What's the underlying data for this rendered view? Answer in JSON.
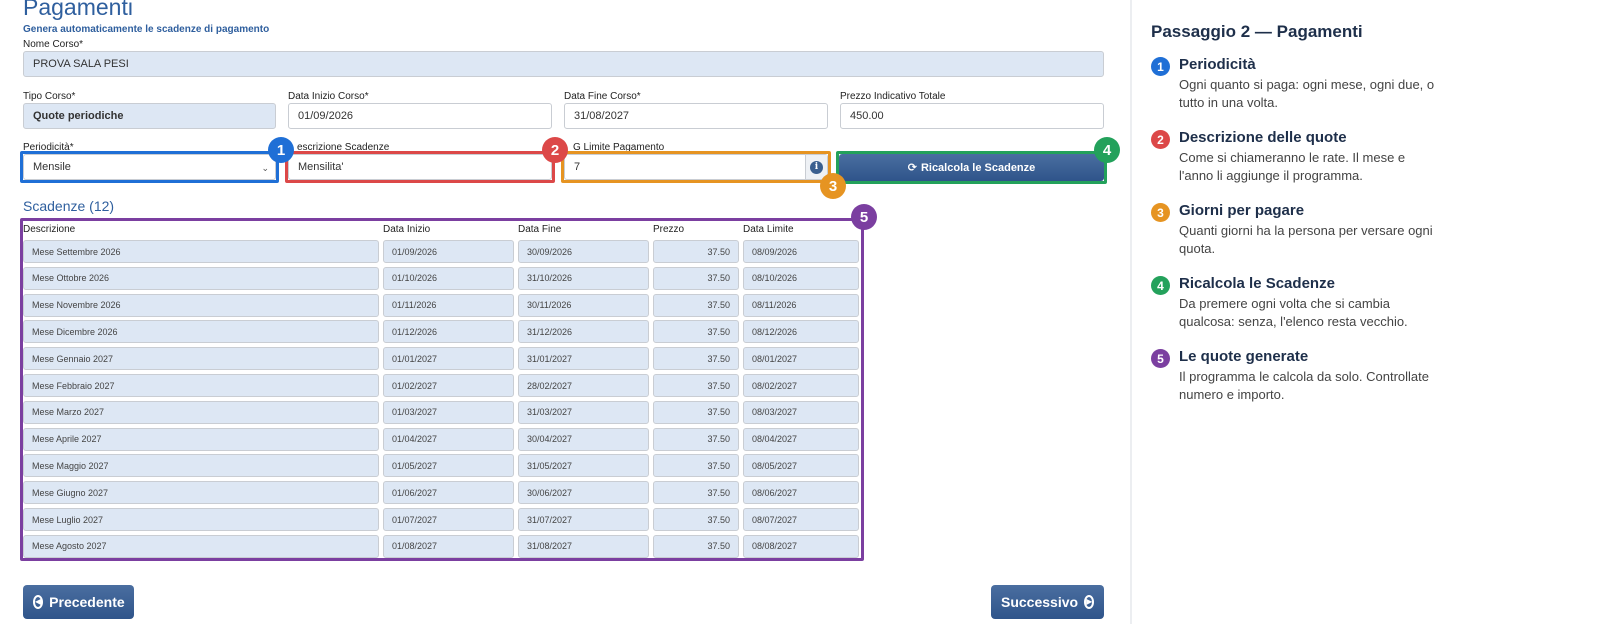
{
  "header": {
    "title": "Pagamenti",
    "subtitle": "Genera automaticamente le scadenze di pagamento"
  },
  "form": {
    "nome_corso_label": "Nome Corso*",
    "nome_corso_value": "PROVA SALA PESI",
    "tipo_corso_label": "Tipo Corso*",
    "tipo_corso_value": "Quote periodiche",
    "data_inizio_label": "Data Inizio Corso*",
    "data_inizio_value": "01/09/2026",
    "data_fine_label": "Data Fine Corso*",
    "data_fine_value": "31/08/2027",
    "prezzo_label": "Prezzo Indicativo Totale",
    "prezzo_value": "450.00",
    "periodicita_label": "Periodicità*",
    "periodicita_value": "Mensile",
    "descrizione_label": "escrizione Scadenze",
    "descrizione_value": "Mensilita'",
    "gg_limite_label": "G Limite Pagamento",
    "gg_limite_value": "7",
    "recalc_label": "Ricalcola le Scadenze"
  },
  "badges": [
    "1",
    "2",
    "3",
    "4",
    "5"
  ],
  "colors": {
    "blue": "#1f6fd6",
    "red": "#dc4848",
    "orange": "#e69422",
    "green": "#23a15b",
    "purple": "#7b3fa0",
    "accent": "#2f5f9e"
  },
  "scadenze": {
    "title": "Scadenze (12)",
    "headers": [
      "Descrizione",
      "Data Inizio",
      "Data Fine",
      "Prezzo",
      "Data Limite"
    ],
    "rows": [
      [
        "Mese Settembre 2026",
        "01/09/2026",
        "30/09/2026",
        "37.50",
        "08/09/2026"
      ],
      [
        "Mese Ottobre 2026",
        "01/10/2026",
        "31/10/2026",
        "37.50",
        "08/10/2026"
      ],
      [
        "Mese Novembre 2026",
        "01/11/2026",
        "30/11/2026",
        "37.50",
        "08/11/2026"
      ],
      [
        "Mese Dicembre 2026",
        "01/12/2026",
        "31/12/2026",
        "37.50",
        "08/12/2026"
      ],
      [
        "Mese Gennaio 2027",
        "01/01/2027",
        "31/01/2027",
        "37.50",
        "08/01/2027"
      ],
      [
        "Mese Febbraio 2027",
        "01/02/2027",
        "28/02/2027",
        "37.50",
        "08/02/2027"
      ],
      [
        "Mese Marzo 2027",
        "01/03/2027",
        "31/03/2027",
        "37.50",
        "08/03/2027"
      ],
      [
        "Mese Aprile 2027",
        "01/04/2027",
        "30/04/2027",
        "37.50",
        "08/04/2027"
      ],
      [
        "Mese Maggio 2027",
        "01/05/2027",
        "31/05/2027",
        "37.50",
        "08/05/2027"
      ],
      [
        "Mese Giugno 2027",
        "01/06/2027",
        "30/06/2027",
        "37.50",
        "08/06/2027"
      ],
      [
        "Mese Luglio 2027",
        "01/07/2027",
        "31/07/2027",
        "37.50",
        "08/07/2027"
      ],
      [
        "Mese Agosto 2027",
        "01/08/2027",
        "31/08/2027",
        "37.50",
        "08/08/2027"
      ]
    ]
  },
  "nav": {
    "prev_label": "Precedente",
    "next_label": "Successivo"
  },
  "side": {
    "title": "Passaggio 2 — Pagamenti",
    "steps": [
      {
        "num": "1",
        "title": "Periodicità",
        "desc": "Ogni quanto si paga: ogni mese, ogni due, o tutto in una volta."
      },
      {
        "num": "2",
        "title": "Descrizione delle quote",
        "desc": "Come si chiameranno le rate. Il mese e l'anno li aggiunge il programma."
      },
      {
        "num": "3",
        "title": "Giorni per pagare",
        "desc": "Quanti giorni ha la persona per versare ogni quota."
      },
      {
        "num": "4",
        "title": "Ricalcola le Scadenze",
        "desc": "Da premere ogni volta che si cambia qualcosa: senza, l'elenco resta vecchio."
      },
      {
        "num": "5",
        "title": "Le quote generate",
        "desc": "Il programma le calcola da solo. Controllate numero e importo."
      }
    ]
  }
}
